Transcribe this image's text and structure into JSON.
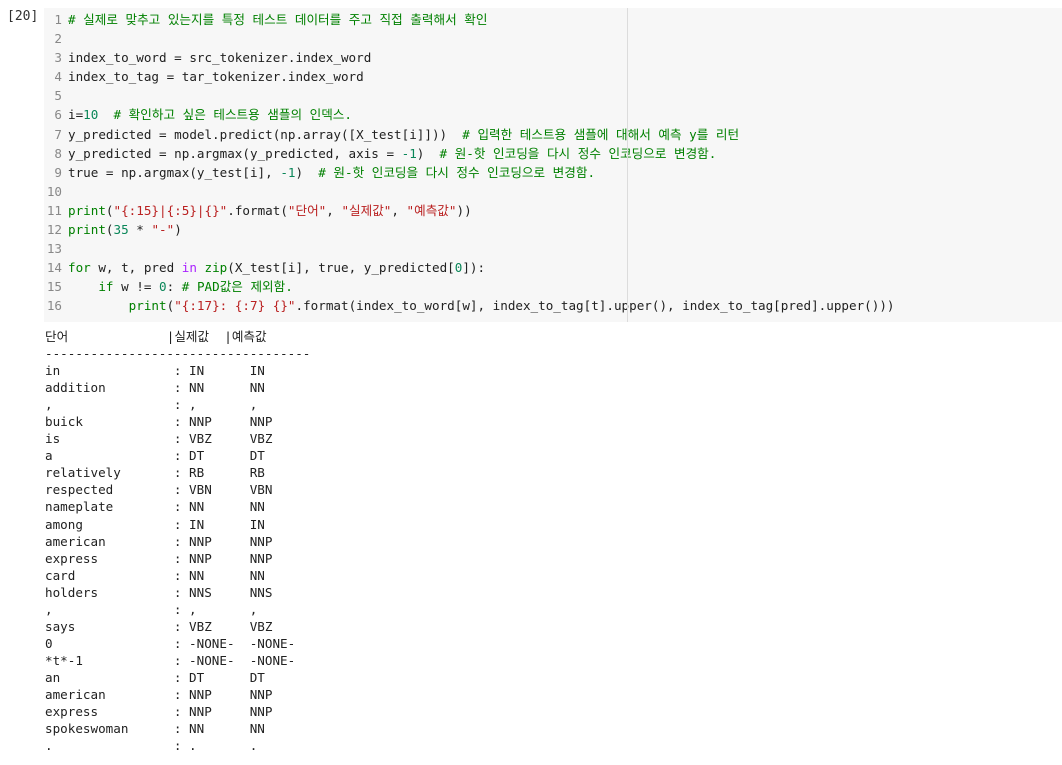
{
  "cell": {
    "execution_count": "[20]",
    "code_lines": [
      {
        "n": "1",
        "parts": [
          {
            "c": "com",
            "t": "# 실제로 맞추고 있는지를 특정 테스트 데이터를 주고 직접 출력해서 확인"
          }
        ]
      },
      {
        "n": "2",
        "parts": []
      },
      {
        "n": "3",
        "parts": [
          {
            "c": "op",
            "t": "index_to_word = src_tokenizer.index_word"
          }
        ]
      },
      {
        "n": "4",
        "parts": [
          {
            "c": "op",
            "t": "index_to_tag = tar_tokenizer.index_word"
          }
        ]
      },
      {
        "n": "5",
        "parts": []
      },
      {
        "n": "6",
        "parts": [
          {
            "c": "op",
            "t": "i="
          },
          {
            "c": "num",
            "t": "10"
          },
          {
            "c": "op",
            "t": "  "
          },
          {
            "c": "com",
            "t": "# 확인하고 싶은 테스트용 샘플의 인덱스."
          }
        ]
      },
      {
        "n": "7",
        "parts": [
          {
            "c": "op",
            "t": "y_predicted = model.predict(np.array([X_test[i]]))  "
          },
          {
            "c": "com",
            "t": "# 입력한 테스트용 샘플에 대해서 예측 y를 리턴"
          }
        ]
      },
      {
        "n": "8",
        "parts": [
          {
            "c": "op",
            "t": "y_predicted = np.argmax(y_predicted, axis = "
          },
          {
            "c": "num",
            "t": "-1"
          },
          {
            "c": "op",
            "t": ")  "
          },
          {
            "c": "com",
            "t": "# 원-핫 인코딩을 다시 정수 인코딩으로 변경함."
          }
        ]
      },
      {
        "n": "9",
        "parts": [
          {
            "c": "op",
            "t": "true = np.argmax(y_test[i], "
          },
          {
            "c": "num",
            "t": "-1"
          },
          {
            "c": "op",
            "t": ")  "
          },
          {
            "c": "com",
            "t": "# 원-핫 인코딩을 다시 정수 인코딩으로 변경함."
          }
        ]
      },
      {
        "n": "10",
        "parts": []
      },
      {
        "n": "11",
        "parts": [
          {
            "c": "kw",
            "t": "print"
          },
          {
            "c": "op",
            "t": "("
          },
          {
            "c": "str",
            "t": "\"{:15}|{:5}|{}\""
          },
          {
            "c": "op",
            "t": ".format("
          },
          {
            "c": "str",
            "t": "\"단어\""
          },
          {
            "c": "op",
            "t": ", "
          },
          {
            "c": "str",
            "t": "\"실제값\""
          },
          {
            "c": "op",
            "t": ", "
          },
          {
            "c": "str",
            "t": "\"예측값\""
          },
          {
            "c": "op",
            "t": "))"
          }
        ]
      },
      {
        "n": "12",
        "parts": [
          {
            "c": "kw",
            "t": "print"
          },
          {
            "c": "op",
            "t": "("
          },
          {
            "c": "num",
            "t": "35"
          },
          {
            "c": "op",
            "t": " * "
          },
          {
            "c": "str",
            "t": "\"-\""
          },
          {
            "c": "op",
            "t": ")"
          }
        ]
      },
      {
        "n": "13",
        "parts": []
      },
      {
        "n": "14",
        "parts": [
          {
            "c": "kw",
            "t": "for"
          },
          {
            "c": "op",
            "t": " w, t, pred "
          },
          {
            "c": "kw2",
            "t": "in"
          },
          {
            "c": "op",
            "t": " "
          },
          {
            "c": "kw",
            "t": "zip"
          },
          {
            "c": "op",
            "t": "(X_test[i], true, y_predicted["
          },
          {
            "c": "num",
            "t": "0"
          },
          {
            "c": "op",
            "t": "]):"
          }
        ]
      },
      {
        "n": "15",
        "parts": [
          {
            "c": "op",
            "t": "    "
          },
          {
            "c": "kw",
            "t": "if"
          },
          {
            "c": "op",
            "t": " w != "
          },
          {
            "c": "num",
            "t": "0"
          },
          {
            "c": "op",
            "t": ": "
          },
          {
            "c": "com",
            "t": "# PAD값은 제외함."
          }
        ]
      },
      {
        "n": "16",
        "parts": [
          {
            "c": "op",
            "t": "        "
          },
          {
            "c": "kw",
            "t": "print"
          },
          {
            "c": "op",
            "t": "("
          },
          {
            "c": "str",
            "t": "\"{:17}: {:7} {}\""
          },
          {
            "c": "op",
            "t": ".format(index_to_word[w], index_to_tag[t].upper(), index_to_tag[pred].upper()))"
          }
        ]
      }
    ],
    "output_lines": [
      "단어             |실제값  |예측값",
      "-----------------------------------",
      "in               : IN      IN",
      "addition         : NN      NN",
      ",                : ,       ,",
      "buick            : NNP     NNP",
      "is               : VBZ     VBZ",
      "a                : DT      DT",
      "relatively       : RB      RB",
      "respected        : VBN     VBN",
      "nameplate        : NN      NN",
      "among            : IN      IN",
      "american         : NNP     NNP",
      "express          : NNP     NNP",
      "card             : NN      NN",
      "holders          : NNS     NNS",
      ",                : ,       ,",
      "says             : VBZ     VBZ",
      "0                : -NONE-  -NONE-",
      "*t*-1            : -NONE-  -NONE-",
      "an               : DT      DT",
      "american         : NNP     NNP",
      "express          : NNP     NNP",
      "spokeswoman      : NN      NN",
      ".                : .       ."
    ]
  },
  "colors": {
    "editor_bg": "#f7f7f7",
    "keyword": "#008000",
    "comment": "#008000",
    "string": "#ba2121",
    "number": "#098658",
    "in_keyword": "#aa22ff"
  }
}
